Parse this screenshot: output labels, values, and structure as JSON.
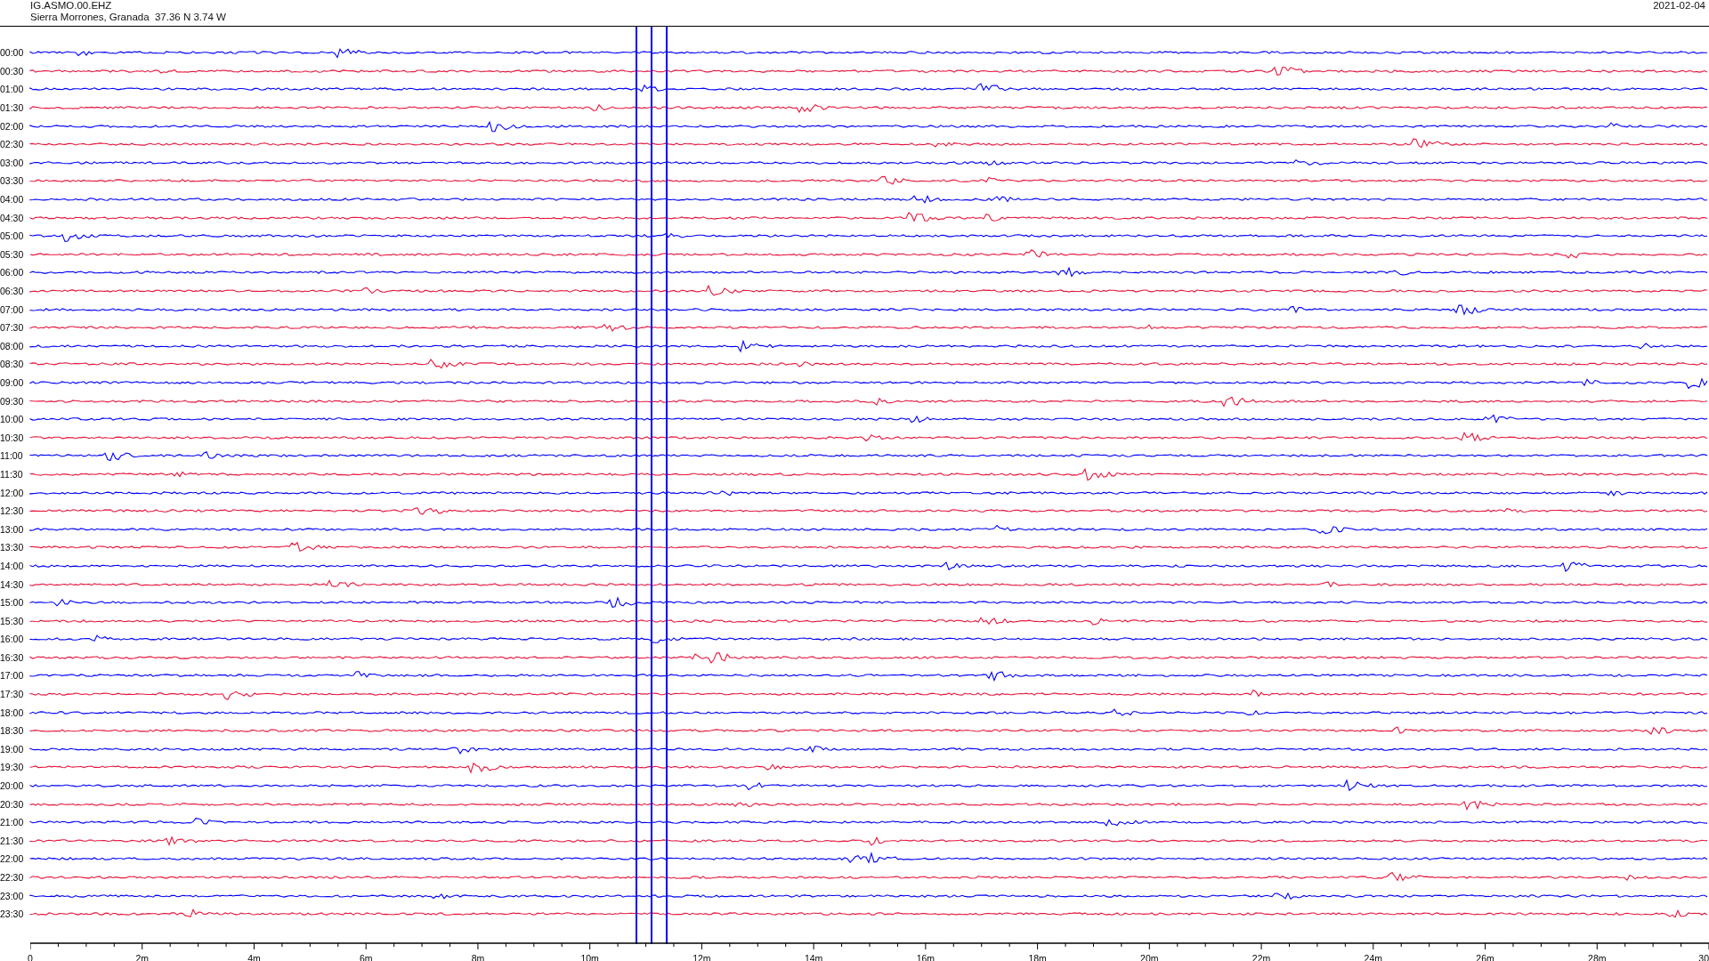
{
  "header": {
    "station": "IG.ASMO.00.EHZ",
    "location": "Sierra Morrones, Granada  37.36 N 3.74 W",
    "date": "2021-02-04"
  },
  "traces": [
    {
      "time": "00:00",
      "color": "#0000ff"
    },
    {
      "time": "00:30",
      "color": "#e8173c"
    },
    {
      "time": "01:00",
      "color": "#0000ff"
    },
    {
      "time": "01:30",
      "color": "#e8173c"
    },
    {
      "time": "02:00",
      "color": "#0000ff"
    },
    {
      "time": "02:30",
      "color": "#e8173c"
    },
    {
      "time": "03:00",
      "color": "#0000ff"
    },
    {
      "time": "03:30",
      "color": "#e8173c"
    },
    {
      "time": "04:00",
      "color": "#0000ff"
    },
    {
      "time": "04:30",
      "color": "#e8173c"
    },
    {
      "time": "05:00",
      "color": "#0000ff"
    },
    {
      "time": "05:30",
      "color": "#e8173c"
    },
    {
      "time": "06:00",
      "color": "#0000ff"
    },
    {
      "time": "06:30",
      "color": "#e8173c"
    },
    {
      "time": "07:00",
      "color": "#0000ff"
    },
    {
      "time": "07:30",
      "color": "#e8173c"
    },
    {
      "time": "08:00",
      "color": "#0000ff"
    },
    {
      "time": "08:30",
      "color": "#e8173c"
    },
    {
      "time": "09:00",
      "color": "#0000ff"
    },
    {
      "time": "09:30",
      "color": "#e8173c"
    },
    {
      "time": "10:00",
      "color": "#0000ff"
    },
    {
      "time": "10:30",
      "color": "#e8173c"
    },
    {
      "time": "11:00",
      "color": "#0000ff"
    },
    {
      "time": "11:30",
      "color": "#e8173c"
    },
    {
      "time": "12:00",
      "color": "#0000ff"
    },
    {
      "time": "12:30",
      "color": "#e8173c"
    },
    {
      "time": "13:00",
      "color": "#0000ff"
    },
    {
      "time": "13:30",
      "color": "#e8173c"
    },
    {
      "time": "14:00",
      "color": "#0000ff"
    },
    {
      "time": "14:30",
      "color": "#e8173c"
    },
    {
      "time": "15:00",
      "color": "#0000ff"
    },
    {
      "time": "15:30",
      "color": "#e8173c"
    },
    {
      "time": "16:00",
      "color": "#0000ff"
    },
    {
      "time": "16:30",
      "color": "#e8173c"
    },
    {
      "time": "17:00",
      "color": "#0000ff"
    },
    {
      "time": "17:30",
      "color": "#e8173c"
    },
    {
      "time": "18:00",
      "color": "#0000ff"
    },
    {
      "time": "18:30",
      "color": "#e8173c"
    },
    {
      "time": "19:00",
      "color": "#0000ff"
    },
    {
      "time": "19:30",
      "color": "#e8173c"
    },
    {
      "time": "20:00",
      "color": "#0000ff"
    },
    {
      "time": "20:30",
      "color": "#e8173c"
    },
    {
      "time": "21:00",
      "color": "#0000ff"
    },
    {
      "time": "21:30",
      "color": "#e8173c"
    },
    {
      "time": "22:00",
      "color": "#0000ff"
    },
    {
      "time": "22:30",
      "color": "#e8173c"
    },
    {
      "time": "23:00",
      "color": "#0000ff"
    },
    {
      "time": "23:30",
      "color": "#e8173c"
    }
  ],
  "x_axis": {
    "ticks": [
      "0",
      "2m",
      "4m",
      "6m",
      "8m",
      "10m",
      "12m",
      "14m",
      "16m",
      "18m",
      "20m",
      "22m",
      "24m",
      "26m",
      "28m",
      "30"
    ]
  }
}
